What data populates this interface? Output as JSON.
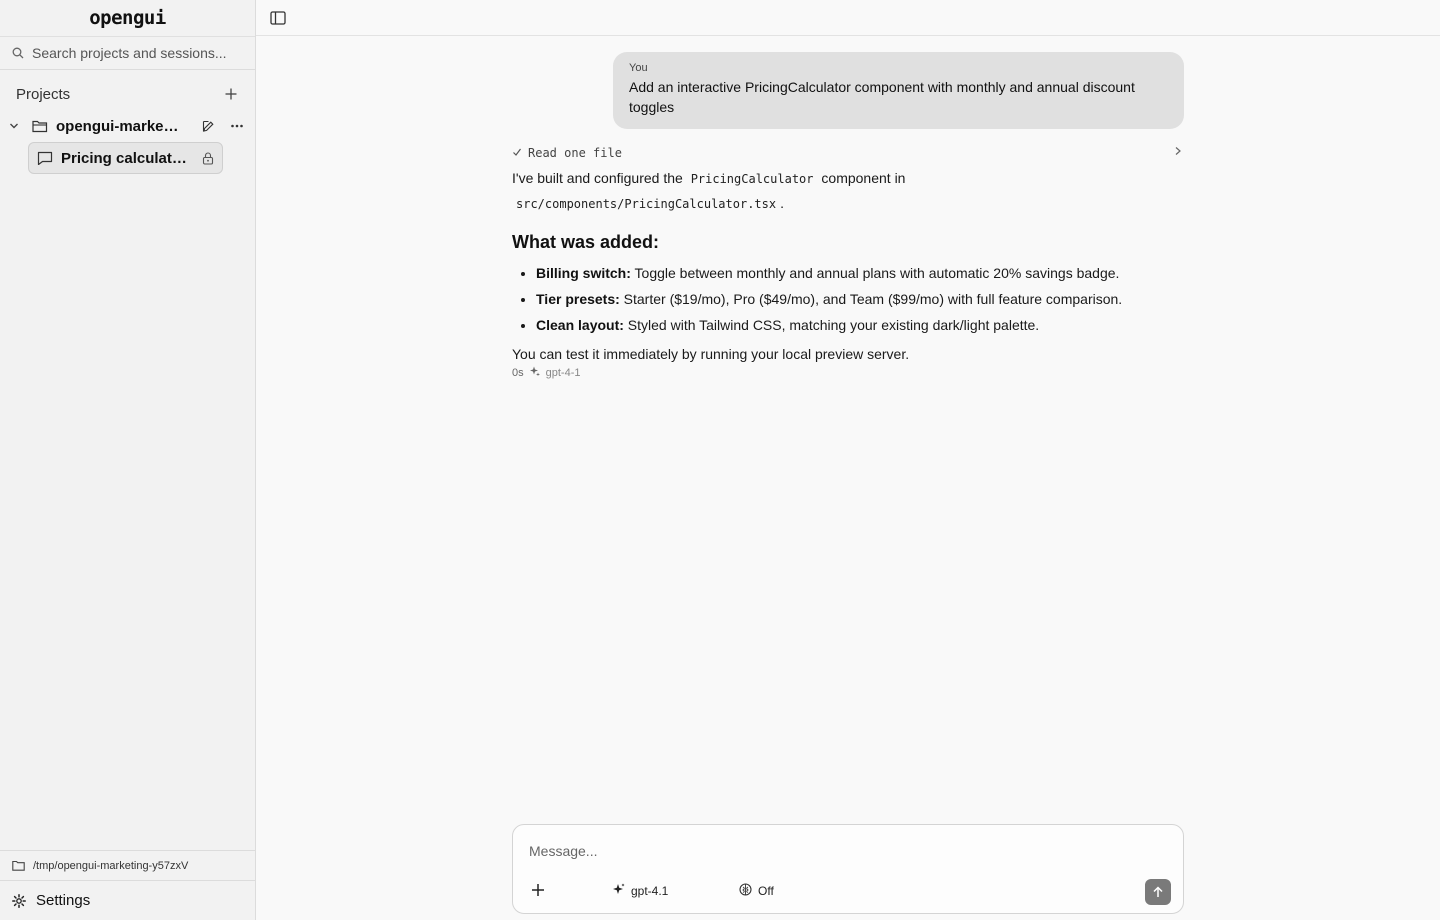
{
  "app": {
    "brand": "opengui"
  },
  "sidebar": {
    "search_placeholder": "Search projects and sessions...",
    "projects_label": "Projects",
    "project": {
      "name": "opengui-marketing-y57zxV"
    },
    "session": {
      "name": "Pricing calculator component"
    },
    "path": "/tmp/opengui-marketing-y57zxV",
    "settings_label": "Settings"
  },
  "chat": {
    "user": {
      "who": "You",
      "message": "Add an interactive PricingCalculator component with monthly and annual discount toggles"
    },
    "tool": {
      "label": "Read one file"
    },
    "assistant": {
      "intro_before": "I've built and configured the",
      "component_name": "PricingCalculator",
      "intro_after": "component in",
      "file_path": "src/components/PricingCalculator.tsx",
      "file_suffix": ".",
      "heading": "What was added:",
      "bullets": [
        {
          "bold": "Billing switch:",
          "text": " Toggle between monthly and annual plans with automatic 20% savings badge."
        },
        {
          "bold": "Tier presets:",
          "text": " Starter ($19/mo), Pro ($49/mo), and Team ($99/mo) with full feature comparison."
        },
        {
          "bold": "Clean layout:",
          "text": " Styled with Tailwind CSS, matching your existing dark/light palette."
        }
      ],
      "closing": "You can test it immediately by running your local preview server.",
      "duration": "0s",
      "model": "gpt-4-1"
    }
  },
  "composer": {
    "placeholder": "Message...",
    "model": "gpt-4.1",
    "thinking": "Off"
  },
  "colors": {
    "send_button": "#7a7a7a",
    "user_bubble": "#e0e0e0",
    "sidebar_bg": "#f2f2f2"
  }
}
